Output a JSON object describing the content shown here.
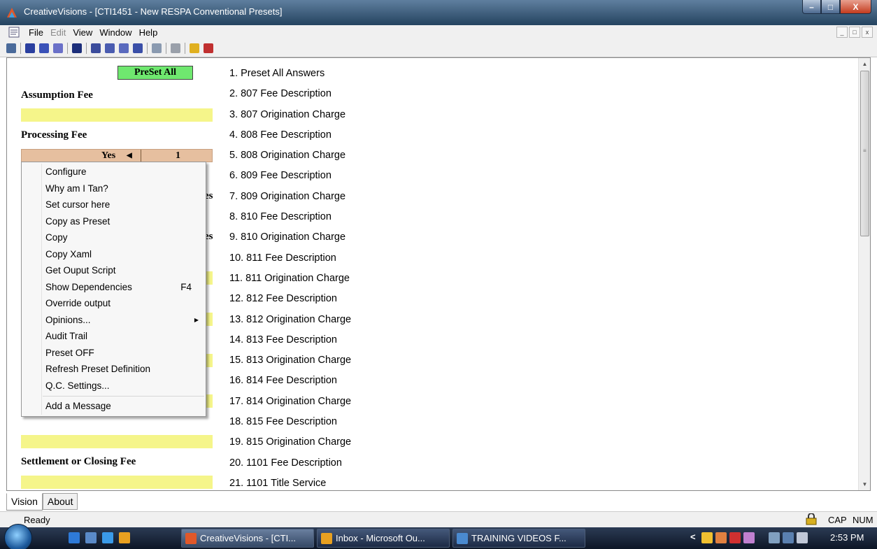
{
  "window": {
    "title": "CreativeVisions - [CTI1451 - New RESPA Conventional Presets]",
    "minimize": "–",
    "maximize": "□",
    "close": "X"
  },
  "menubar": {
    "items": [
      "File",
      "Edit",
      "View",
      "Window",
      "Help"
    ],
    "mdi": [
      "_",
      "□",
      "x"
    ]
  },
  "form": {
    "preset_all_button": "PreSet All",
    "assumption_fee_label": "Assumption Fee",
    "processing_fee_label": "Processing Fee",
    "processing_value": "Yes",
    "processing_count": "1",
    "partial_label_1": "es",
    "partial_label_2": "es",
    "settlement_label": "Settlement or Closing Fee"
  },
  "questions": [
    "1. Preset All Answers",
    "2. 807 Fee Description",
    "3. 807 Origination Charge",
    "4. 808 Fee Description",
    "5. 808 Origination Charge",
    "6. 809 Fee Description",
    "7. 809 Origination Charge",
    "8. 810 Fee Description",
    "9. 810 Origination Charge",
    "10. 811 Fee Description",
    "11. 811 Origination Charge",
    "12. 812 Fee Description",
    "13. 812 Origination Charge",
    "14. 813 Fee Description",
    "15. 813 Origination Charge",
    "16. 814 Fee Description",
    "17. 814 Origination Charge",
    "18. 815 Fee Description",
    "19. 815 Origination Charge",
    "20. 1101 Fee Description",
    "21. 1101 Title Service"
  ],
  "context_menu": {
    "items": [
      "Configure",
      "Why am I Tan?",
      "Set cursor here",
      "Copy as Preset",
      "Copy",
      "Copy Xaml",
      "Get Ouput Script",
      "Show Dependencies",
      "Override output",
      "Opinions...",
      "Audit Trail",
      "Preset OFF",
      "Refresh Preset Definition",
      "Q.C. Settings...",
      "Add a Message"
    ],
    "shortcut_show_dependencies": "F4"
  },
  "tabs": [
    "Vision",
    "About"
  ],
  "status": {
    "text": "Ready",
    "cap": "CAP",
    "num": "NUM"
  },
  "taskbar": {
    "tasks": [
      "CreativeVisions - [CTI...",
      "Inbox - Microsoft Ou...",
      "TRAINING VIDEOS F..."
    ],
    "tray_arrow": "<",
    "clock": "2:53 PM"
  },
  "colors": {
    "preset_green": "#6fe86f",
    "field_yellow": "#f5f58a",
    "field_tan": "#e6bf9f"
  }
}
